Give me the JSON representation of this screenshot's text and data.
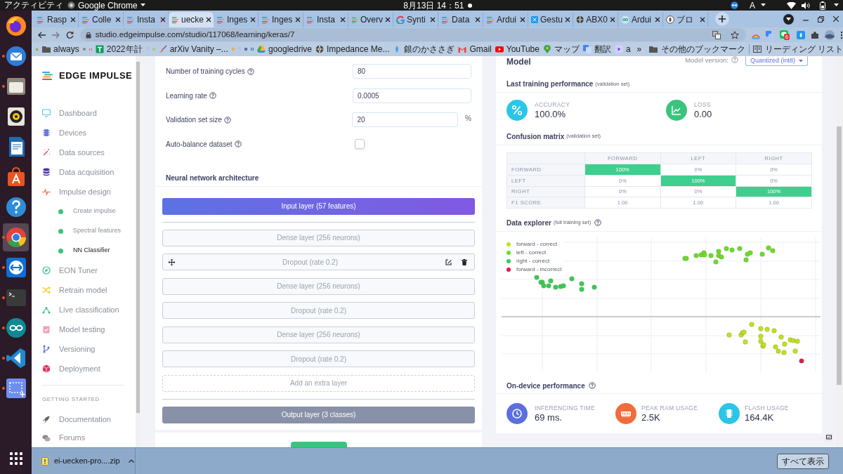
{
  "system_bar": {
    "activities": "アクティビティ",
    "app_menu": "Google Chrome",
    "clock": "8月13日 14：51",
    "input_method": "A"
  },
  "dock": {
    "apps": [
      {
        "running": false,
        "selected": false
      },
      {
        "running": true,
        "selected": false
      },
      {
        "running": true,
        "selected": false
      },
      {
        "running": false,
        "selected": false
      },
      {
        "running": false,
        "selected": false
      },
      {
        "running": false,
        "selected": false
      },
      {
        "running": false,
        "selected": false
      },
      {
        "running": true,
        "selected": true
      },
      {
        "running": true,
        "selected": false
      },
      {
        "running": true,
        "selected": false
      },
      {
        "running": true,
        "selected": false
      },
      {
        "running": true,
        "selected": false
      },
      {
        "running": true,
        "selected": false
      }
    ]
  },
  "browser": {
    "tabs": [
      {
        "title": "Rasp",
        "kind": "edge",
        "selected": false
      },
      {
        "title": "Colle",
        "kind": "edge",
        "selected": false
      },
      {
        "title": "Insta",
        "kind": "edge",
        "selected": false
      },
      {
        "title": "uecke",
        "kind": "edge",
        "selected": true
      },
      {
        "title": "Inges",
        "kind": "edge",
        "selected": false
      },
      {
        "title": "Inges",
        "kind": "edge",
        "selected": false
      },
      {
        "title": "Insta",
        "kind": "edge",
        "selected": false
      },
      {
        "title": "Overv",
        "kind": "edge",
        "selected": false
      },
      {
        "title": "Synti",
        "kind": "google",
        "selected": false
      },
      {
        "title": "Data",
        "kind": "edge",
        "selected": false
      },
      {
        "title": "Ardui",
        "kind": "edge",
        "selected": false
      },
      {
        "title": "Gestu",
        "kind": "grid",
        "selected": false
      },
      {
        "title": "ABX0",
        "kind": "globe",
        "selected": false
      },
      {
        "title": "Ardui",
        "kind": "arduino",
        "selected": false
      },
      {
        "title": "ブロ",
        "kind": "blog",
        "selected": false
      }
    ],
    "url": "studio.edgeimpulse.com/studio/117068/learning/keras/7",
    "extension_badge": "6",
    "bookmarks": [
      {
        "kind": "drive"
      },
      {
        "kind": "folder",
        "label": "always"
      },
      {
        "kind": "globe"
      },
      {
        "kind": "gmail"
      },
      {
        "kind": "sheet",
        "label": "2022年計"
      },
      {
        "kind": "google"
      },
      {
        "kind": "ring"
      },
      {
        "kind": "broom",
        "label": "arXiv Vanity –..."
      },
      {
        "kind": "office"
      },
      {
        "kind": "google"
      },
      {
        "kind": "book"
      },
      {
        "kind": "note"
      },
      {
        "kind": "drive",
        "label": "googledrive"
      },
      {
        "kind": "globe",
        "label": "Impedance Me..."
      },
      {
        "kind": "bird",
        "label": "銀のかささぎ"
      },
      {
        "kind": "gmail",
        "label": "Gmail"
      },
      {
        "kind": "youtube",
        "label": "YouTube"
      },
      {
        "kind": "maps",
        "label": "マップ"
      },
      {
        "kind": "translate",
        "label": "翻訳"
      },
      {
        "kind": "video",
        "label": "a"
      }
    ],
    "overflow": "»",
    "other_bookmarks": "その他のブックマーク",
    "reading_list": "リーディング リスト"
  },
  "sidebar": {
    "logo": "EDGE IMPULSE",
    "nav": [
      {
        "label": "Dashboard",
        "selected": false
      },
      {
        "label": "Devices",
        "selected": false
      },
      {
        "label": "Data sources",
        "selected": false
      },
      {
        "label": "Data acquisition",
        "selected": false
      },
      {
        "label": "Impulse design",
        "selected": false,
        "children": [
          {
            "label": "Create impulse",
            "selected": false
          },
          {
            "label": "Spectral features",
            "selected": false
          },
          {
            "label": "NN Classifier",
            "selected": true
          }
        ]
      },
      {
        "label": "EON Tuner",
        "selected": false
      },
      {
        "label": "Retrain model",
        "selected": false
      },
      {
        "label": "Live classification",
        "selected": false
      },
      {
        "label": "Model testing",
        "selected": false
      },
      {
        "label": "Versioning",
        "selected": false
      },
      {
        "label": "Deployment",
        "selected": false
      }
    ],
    "section_heading": "GETTING STARTED",
    "links": [
      {
        "label": "Documentation"
      },
      {
        "label": "Forums"
      }
    ]
  },
  "settings": [
    {
      "kind": "number",
      "label": "Number of training cycles",
      "value": "80"
    },
    {
      "kind": "number",
      "label": "Learning rate",
      "value": "0.0005"
    },
    {
      "kind": "number",
      "label": "Validation set size",
      "value": "20",
      "unit": "%"
    },
    {
      "kind": "checkbox",
      "label": "Auto-balance dataset",
      "checked": false
    }
  ],
  "architecture": {
    "title": "Neural network architecture",
    "input_layer": "Input layer (57 features)",
    "layers": [
      {
        "label": "Dense layer (256 neurons)",
        "hovered": false
      },
      {
        "label": "Dropout (rate 0.2)",
        "hovered": true
      },
      {
        "label": "Dense layer (256 neurons)",
        "hovered": false
      },
      {
        "label": "Dropout (rate 0.2)",
        "hovered": false
      },
      {
        "label": "Dense layer (256 neurons)",
        "hovered": false
      },
      {
        "label": "Dropout (rate 0.2)",
        "hovered": false
      }
    ],
    "add_layer": "Add an extra layer",
    "output_layer": "Output layer (3 classes)"
  },
  "model": {
    "title": "Model",
    "version_label": "Model version:",
    "version": "Quantized (int8)",
    "last_training": {
      "title": "Last training performance",
      "note": "(validation set)",
      "metrics": [
        {
          "label": "ACCURACY",
          "value": "100.0%"
        },
        {
          "label": "LOSS",
          "value": "0.00"
        }
      ]
    },
    "confusion_matrix": {
      "title": "Confusion matrix",
      "note": "(validation set)",
      "columns": [
        "FORWARD",
        "LEFT",
        "RIGHT"
      ],
      "rows": [
        {
          "label": "FORWARD",
          "cells": [
            {
              "text": "100%",
              "highlighted": true
            },
            {
              "text": "0%",
              "highlighted": false
            },
            {
              "text": "0%",
              "highlighted": false
            }
          ]
        },
        {
          "label": "LEFT",
          "cells": [
            {
              "text": "0%",
              "highlighted": false
            },
            {
              "text": "100%",
              "highlighted": true
            },
            {
              "text": "0%",
              "highlighted": false
            }
          ]
        },
        {
          "label": "RIGHT",
          "cells": [
            {
              "text": "0%",
              "highlighted": false
            },
            {
              "text": "0%",
              "highlighted": false
            },
            {
              "text": "100%",
              "highlighted": true
            }
          ]
        },
        {
          "label": "F1 SCORE",
          "cells": [
            {
              "text": "1.00",
              "highlighted": false
            },
            {
              "text": "1.00",
              "highlighted": false
            },
            {
              "text": "1.00",
              "highlighted": false
            }
          ]
        }
      ]
    },
    "data_explorer": {
      "title": "Data explorer",
      "note": "(full training set)",
      "legend": [
        {
          "label": "forward - correct",
          "color": "#c5de1c"
        },
        {
          "label": "left - correct",
          "color": "#6bdb2c"
        },
        {
          "label": "right - correct",
          "color": "#34c95e"
        },
        {
          "label": "forward - incorrect",
          "color": "#e0174f"
        }
      ]
    },
    "on_device": {
      "title": "On-device performance",
      "metrics": [
        {
          "label": "INFERENCING TIME",
          "value": "69 ms."
        },
        {
          "label": "PEAK RAM USAGE",
          "value": "2.5K"
        },
        {
          "label": "FLASH USAGE",
          "value": "164.4K"
        }
      ]
    }
  },
  "download": {
    "file": "ei-uecken-pro....zip",
    "show_all": "すべて表示"
  }
}
